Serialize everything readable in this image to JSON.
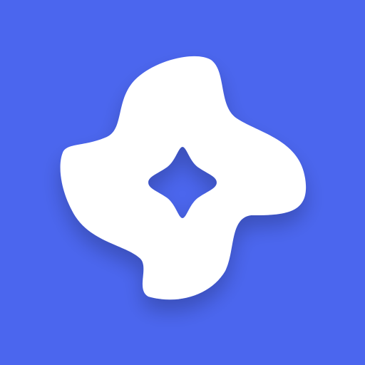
{
  "colors": {
    "background": "#4B66EE",
    "shape": "#FFFFFF",
    "center_star": "#4B66EE"
  },
  "icons": {
    "logo": "pinwheel-logo-icon",
    "center": "four-point-star-icon"
  }
}
